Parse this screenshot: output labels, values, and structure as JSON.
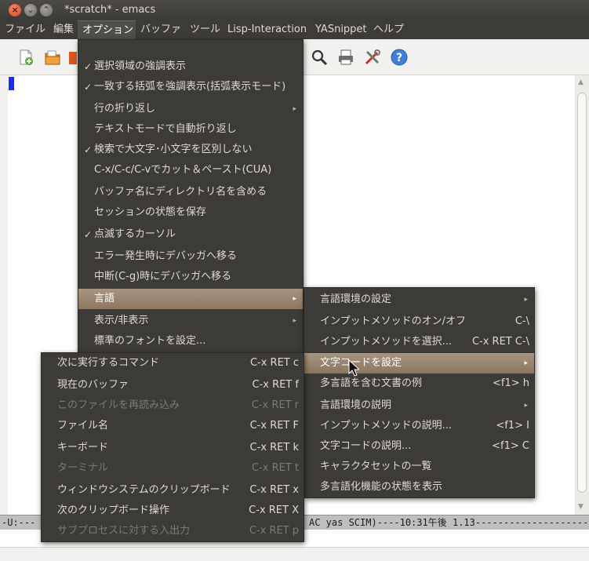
{
  "window": {
    "title": "*scratch* - emacs",
    "close_glyph": "×",
    "min_glyph": "⌄",
    "max_glyph": "⌃"
  },
  "menubar": {
    "items": [
      "ファイル",
      "編集",
      "オプション",
      "バッファ",
      "ツール",
      "Lisp-Interaction",
      "YASnippet",
      "ヘルプ"
    ]
  },
  "options_menu": {
    "items": [
      {
        "label": "選択領域の強調表示",
        "checked": "✓"
      },
      {
        "label": "一致する括弧を強調表示(括弧表示モード)",
        "checked": "✓"
      },
      {
        "label": "行の折り返し",
        "submenu": "▸"
      },
      {
        "label": "テキストモードで自動折り返し"
      },
      {
        "label": "検索で大文字･小文字を区別しない",
        "checked": "✓"
      },
      {
        "label": "C-x/C-c/C-vでカット＆ペースト(CUA)"
      },
      {
        "label": "バッファ名にディレクトリ名を含める"
      },
      {
        "label": "セッションの状態を保存"
      },
      {
        "label": "点滅するカーソル",
        "checked": "✓"
      },
      {
        "label": "エラー発生時にデバッガへ移る"
      },
      {
        "label": "中断(C-g)時にデバッガへ移る"
      },
      {
        "label": "言語",
        "submenu": "▸"
      },
      {
        "label": "表示/非表示",
        "submenu": "▸"
      },
      {
        "label": "標準のフォントを設定..."
      }
    ]
  },
  "language_menu": {
    "items": [
      {
        "label": "言語環境の設定",
        "submenu": "▸"
      },
      {
        "label": "インプットメソッドのオン/オフ",
        "accel": "C-\\"
      },
      {
        "label": "インプットメソッドを選択...",
        "accel": "C-x RET C-\\"
      },
      {
        "label": "文字コードを設定",
        "submenu": "▸"
      },
      {
        "label": "多言語を含む文書の例",
        "accel": "<f1> h"
      },
      {
        "label": "言語環境の説明",
        "submenu": "▸"
      },
      {
        "label": "インプットメソッドの説明...",
        "accel": "<f1> I"
      },
      {
        "label": "文字コードの説明...",
        "accel": "<f1> C"
      },
      {
        "label": "キャラクタセットの一覧"
      },
      {
        "label": "多言語化機能の状態を表示"
      }
    ]
  },
  "coding_menu": {
    "items": [
      {
        "label": "次に実行するコマンド",
        "accel": "C-x RET c"
      },
      {
        "label": "現在のバッファ",
        "accel": "C-x RET f"
      },
      {
        "label": "このファイルを再読み込み",
        "accel": "C-x RET r"
      },
      {
        "label": "ファイル名",
        "accel": "C-x RET F"
      },
      {
        "label": "キーボード",
        "accel": "C-x RET k"
      },
      {
        "label": "ターミナル",
        "accel": "C-x RET t"
      },
      {
        "label": "ウィンドウシステムのクリップボード",
        "accel": "C-x RET x"
      },
      {
        "label": "次のクリップボード操作",
        "accel": "C-x RET X"
      },
      {
        "label": "サブプロセスに対する入出力",
        "accel": "C-x RET p"
      }
    ]
  },
  "modeline": {
    "left": "-U:---",
    "right": "AC yas SCIM)----10:31午後 1.13----------------------"
  },
  "colors": {
    "menu_bg": "#3c3b37",
    "selection": "#a89580",
    "cursor": "#1b2cf0"
  }
}
